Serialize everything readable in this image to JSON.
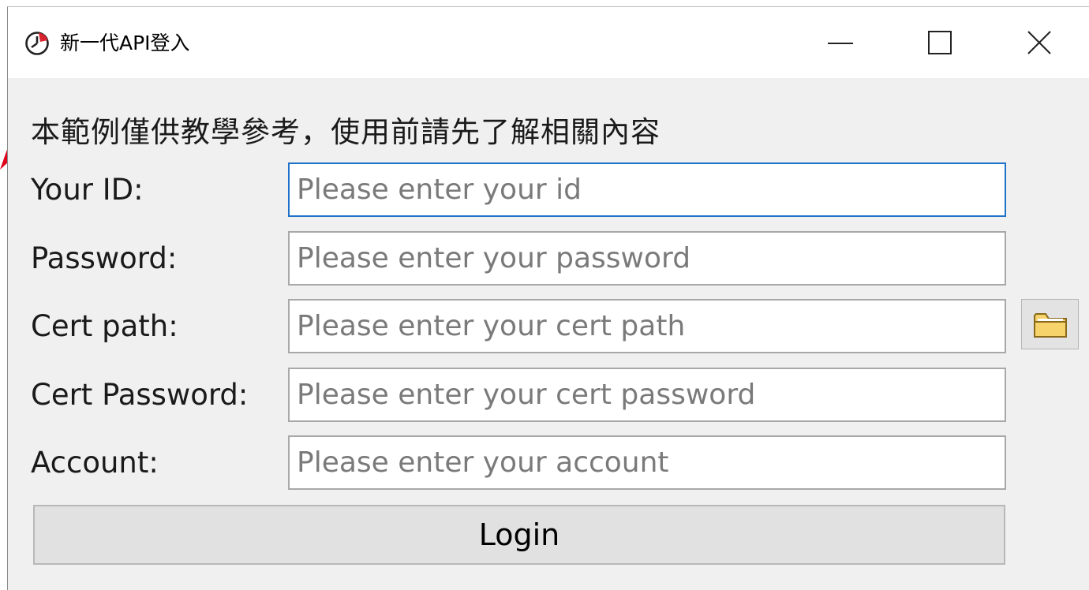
{
  "window": {
    "title": "新一代API登入",
    "icon": "stopwatch-icon"
  },
  "titlebar_buttons": {
    "minimize_icon": "minimize-icon",
    "maximize_icon": "maximize-icon",
    "close_icon": "close-icon"
  },
  "notice": "本範例僅供教學參考，使用前請先了解相關內容",
  "form": {
    "fields": [
      {
        "label": "Your ID:",
        "placeholder": "Please enter your id",
        "value": ""
      },
      {
        "label": "Password:",
        "placeholder": "Please enter your password",
        "value": ""
      },
      {
        "label": "Cert path:",
        "placeholder": "Please enter your cert path",
        "value": ""
      },
      {
        "label": "Cert Password:",
        "placeholder": "Please enter your cert password",
        "value": ""
      },
      {
        "label": "Account:",
        "placeholder": "Please enter your account",
        "value": ""
      }
    ],
    "browse_icon": "folder-icon",
    "login_label": "Login"
  },
  "colors": {
    "window_background": "#f0f0f0",
    "titlebar_background": "#ffffff",
    "focus_border": "#1e73c8",
    "folder_fill": "#f7d36b",
    "annotation_arrow": "#e0001a"
  }
}
